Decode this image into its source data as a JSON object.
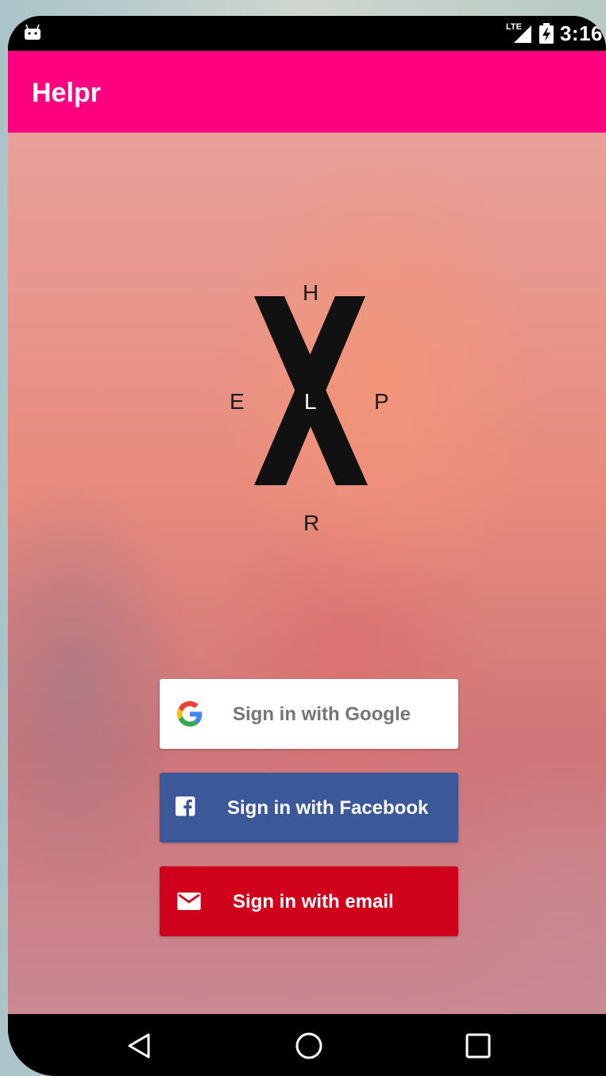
{
  "status_bar": {
    "network": "LTE",
    "time": "3:16"
  },
  "app_bar": {
    "title": "Helpr"
  },
  "logo": {
    "top": "H",
    "left": "E",
    "center": "L",
    "right": "P",
    "bottom": "R",
    "background_glyph": "X"
  },
  "auth_buttons": [
    {
      "label": "Sign in with Google",
      "icon": "google-icon",
      "bg": "#ffffff",
      "fg": "#757575"
    },
    {
      "label": "Sign in with Facebook",
      "icon": "facebook-icon",
      "bg": "#3b5998",
      "fg": "#ffffff"
    },
    {
      "label": "Sign in with email",
      "icon": "mail-icon",
      "bg": "#d0021b",
      "fg": "#ffffff"
    }
  ],
  "colors": {
    "accent": "#ff0080"
  },
  "nav_bar": {
    "back_icon": "back-triangle-icon",
    "home_icon": "home-circle-icon",
    "recent_icon": "recent-square-icon"
  }
}
